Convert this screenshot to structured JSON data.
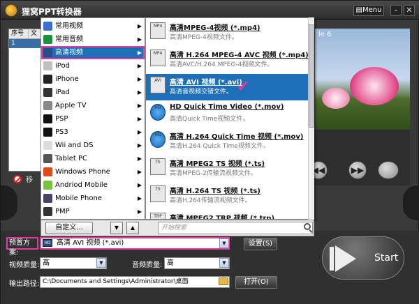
{
  "app": {
    "title": "狸窝PPT转换器",
    "menu_label": "▤Menu",
    "minimize": "–",
    "close": "✕"
  },
  "list": {
    "col_index": "序号",
    "col_file": "文",
    "row_index": "1"
  },
  "remove_label": "移",
  "preview_text": "le 6",
  "menu1": {
    "items": [
      {
        "label": "常用视频",
        "icon": "video-icon",
        "color": "#3b6fd0"
      },
      {
        "label": "常用音频",
        "icon": "audio-icon",
        "color": "#1e8f3e"
      },
      {
        "label": "高清视频",
        "icon": "hd-video-icon",
        "color": "#2a4a8a",
        "selected": true
      },
      {
        "label": "iPod",
        "icon": "ipod-icon",
        "color": "#c0c0c0"
      },
      {
        "label": "iPhone",
        "icon": "iphone-icon",
        "color": "#222"
      },
      {
        "label": "iPad",
        "icon": "ipad-icon",
        "color": "#333"
      },
      {
        "label": "Apple TV",
        "icon": "apple-tv-icon",
        "color": "#888"
      },
      {
        "label": "PSP",
        "icon": "psp-icon",
        "color": "#111"
      },
      {
        "label": "PS3",
        "icon": "ps3-icon",
        "color": "#111"
      },
      {
        "label": "Wii and DS",
        "icon": "wii-icon",
        "color": "#ddd"
      },
      {
        "label": "Tablet PC",
        "icon": "tablet-icon",
        "color": "#555"
      },
      {
        "label": "Windows Phone",
        "icon": "windows-icon",
        "color": "#e04b1a"
      },
      {
        "label": "Andriod Mobile",
        "icon": "android-icon",
        "color": "#7cc242"
      },
      {
        "label": "Mobile Phone",
        "icon": "mobile-icon",
        "color": "#446"
      },
      {
        "label": "PMP",
        "icon": "pmp-icon",
        "color": "#333"
      }
    ]
  },
  "menu2": {
    "formats": [
      {
        "title": "高清MPEG-4视频 (*.mp4)",
        "desc": "高清MPEG-4视频文件。",
        "badge": "MP4",
        "icon": "mp4-icon"
      },
      {
        "title": "高清 H.264 MPEG-4 AVC 视频 (*.mp4)",
        "desc": "高清AVC/H.264 MPEG-4视频文件。",
        "badge": "MP4",
        "icon": "mp4-avc-icon"
      },
      {
        "title": "高清 AVI 视频 (*.avi)",
        "desc": "高清音视频交错文件。",
        "badge": "AVI",
        "icon": "avi-icon",
        "selected": true
      },
      {
        "title": "HD Quick Time Video (*.mov)",
        "desc": "高清Quick Time视频文件。",
        "badge": "HD",
        "icon": "quicktime-icon"
      },
      {
        "title": "高清 H.264 Quick Time 视频 (*.mov)",
        "desc": "高清H.264 Quick Time视频文件。",
        "badge": "HD",
        "icon": "quicktime-h264-icon"
      },
      {
        "title": "高清 MPEG2 TS 视频 (*.ts)",
        "desc": "高清MPEG-2传输流视频文件。",
        "badge": "TS",
        "icon": "ts-icon"
      },
      {
        "title": "高清 H.264 TS 视频 (*.ts)",
        "desc": "高清H.264传输流视频文件。",
        "badge": "TS",
        "icon": "ts-h264-icon"
      },
      {
        "title": "高清 MPEG2 TRP 视频 (*.trp)",
        "desc": "",
        "badge": "TRP",
        "icon": "trp-icon"
      }
    ],
    "checkmark": "✔"
  },
  "footer": {
    "custom_label": "自定义...",
    "down": "▼",
    "up": "▲",
    "search_placeholder": "开始搜索"
  },
  "settings": {
    "preset_label": "预置方案:",
    "preset_value": "高清 AVI 视频 (*.avi)",
    "preset_badge": "HD",
    "settings_button": "设置(S)",
    "video_quality_label": "视频质量:",
    "video_quality_value": "高",
    "audio_quality_label": "音频质量:",
    "audio_quality_value": "高",
    "output_label": "输出路径:",
    "output_path": "C:\\Documents and Settings\\Administrator\\桌面",
    "open_button": "打开(O)",
    "start_label": "Start"
  },
  "preview_controls": {
    "prev": "◀◀",
    "next": "▶▶"
  }
}
